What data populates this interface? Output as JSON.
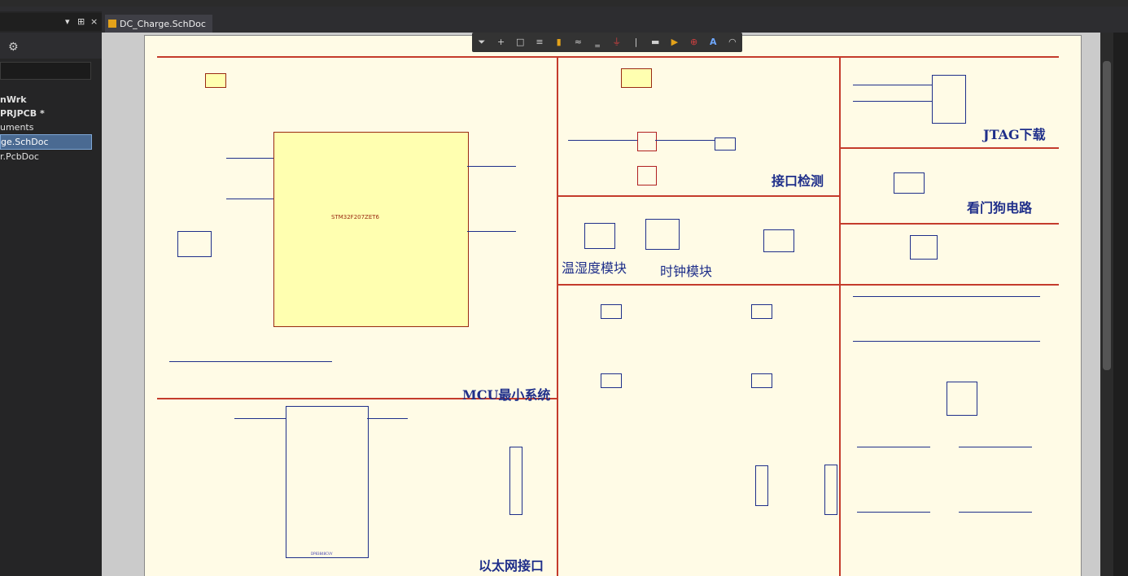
{
  "window": {
    "panel_buttons": [
      "▾",
      "⊞",
      "×"
    ],
    "gear_icon": "gear-icon"
  },
  "project_tree": {
    "items": [
      {
        "label": "nWrk",
        "bold": true
      },
      {
        "label": "PRJPCB *",
        "bold": true
      },
      {
        "label": "uments",
        "bold": false
      },
      {
        "label": "ge.SchDoc",
        "bold": false,
        "selected": true
      },
      {
        "label": "r.PcbDoc",
        "bold": false
      }
    ]
  },
  "document_tab": {
    "label": "DC_Charge.SchDoc"
  },
  "toolbar": {
    "icons": [
      "filter-icon",
      "plus-icon",
      "select-rect-icon",
      "align-icon",
      "component-icon",
      "bus-icon",
      "net-icon",
      "power-icon",
      "port-icon",
      "harness-icon",
      "sheet-entry-icon",
      "probe-icon",
      "text-icon",
      "arc-icon"
    ]
  },
  "schematic": {
    "titles": {
      "mcu": "MCU最小系统",
      "iface": "接口检测",
      "jtag": "JTAG下载",
      "watchdog": "看门狗电路",
      "temp": "温湿度模块",
      "clock": "时钟模块",
      "ethernet": "以太网接口"
    },
    "mcu_part": "STM32F207ZET6",
    "eth_part": "DP83848CVV",
    "accent_color": "#c43b2c",
    "wire_color": "#1f2f8a",
    "chip_fill": "#ffffb0"
  }
}
